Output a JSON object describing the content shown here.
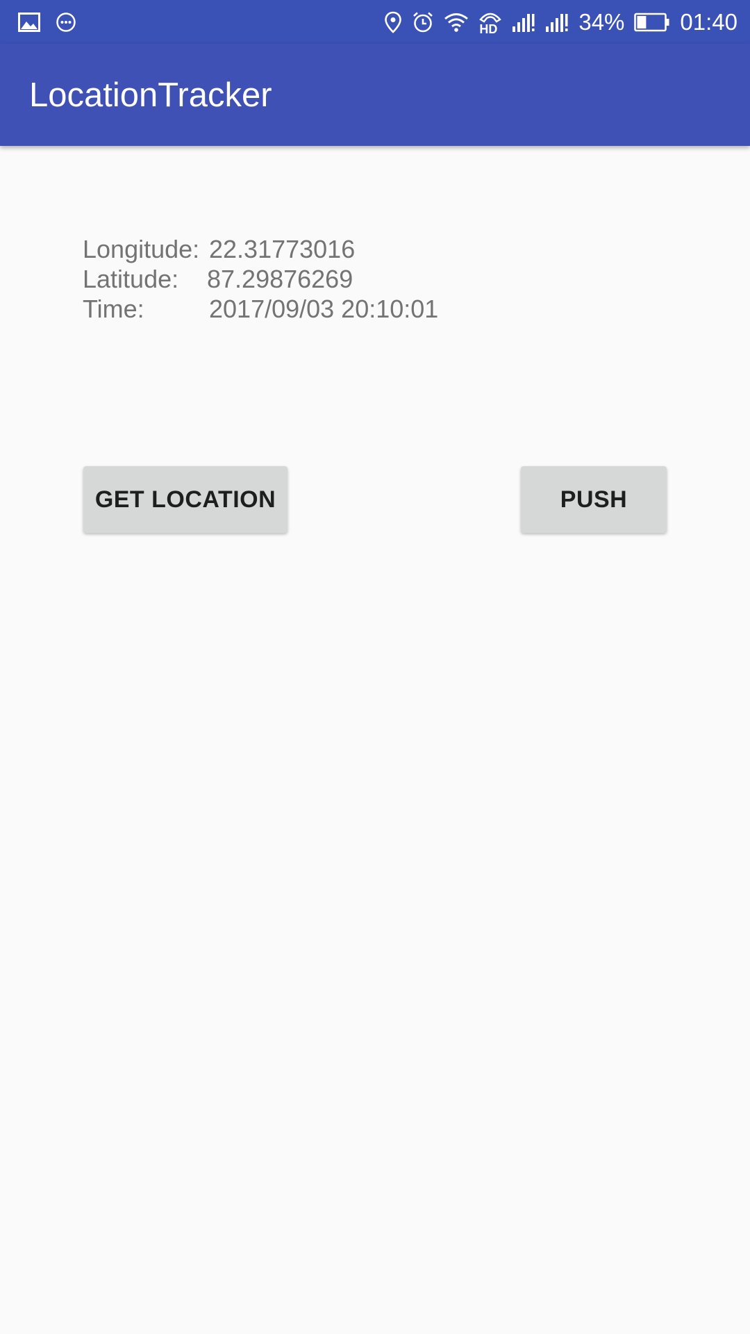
{
  "status_bar": {
    "left_icons": [
      "image-icon",
      "chat-bubble-icon"
    ],
    "right_icons": [
      "location-pin-icon",
      "alarm-icon",
      "wifi-icon",
      "hd-call-icon",
      "signal-icon",
      "signal-icon"
    ],
    "hd_label": "HD",
    "battery_percent": "34%",
    "battery_level": 0.34,
    "time": "01:40"
  },
  "app_bar": {
    "title": "LocationTracker",
    "color": "#3f51b5"
  },
  "location": {
    "longitude_label": "Longitude:",
    "longitude_value": "22.31773016",
    "latitude_label": "Latitude:",
    "latitude_value": "87.29876269",
    "time_label": "Time:",
    "time_value": "2017/09/03 20:10:01"
  },
  "buttons": {
    "get_location": "GET LOCATION",
    "push": "PUSH"
  }
}
